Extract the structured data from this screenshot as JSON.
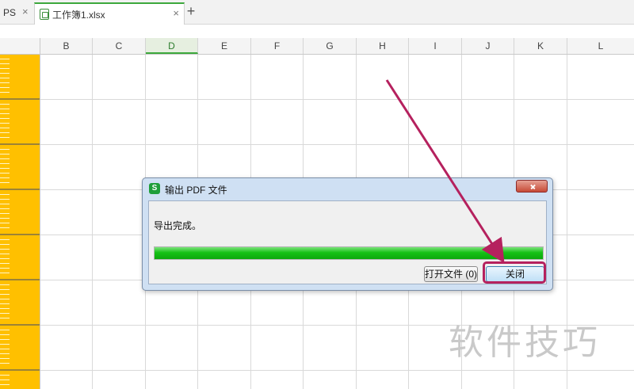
{
  "tabs": {
    "previous": {
      "label": "PS",
      "close": "×"
    },
    "active": {
      "label": "工作簿1.xlsx",
      "close": "×"
    },
    "add": "+"
  },
  "sheet": {
    "columns": [
      "B",
      "C",
      "D",
      "E",
      "F",
      "G",
      "H",
      "I",
      "J",
      "K",
      "L"
    ],
    "selected_column": "D"
  },
  "dialog": {
    "title": "输出 PDF 文件",
    "app_icon": "S",
    "message": "导出完成。",
    "progress_value": 1.0,
    "open_button": "打开文件 (0)",
    "close_button": "关闭"
  },
  "watermark": "软件技巧",
  "colors": {
    "row_header": "#ffc000",
    "progress": "#15c215",
    "annotation": "#b5215e",
    "accent": "#3ca83c"
  }
}
